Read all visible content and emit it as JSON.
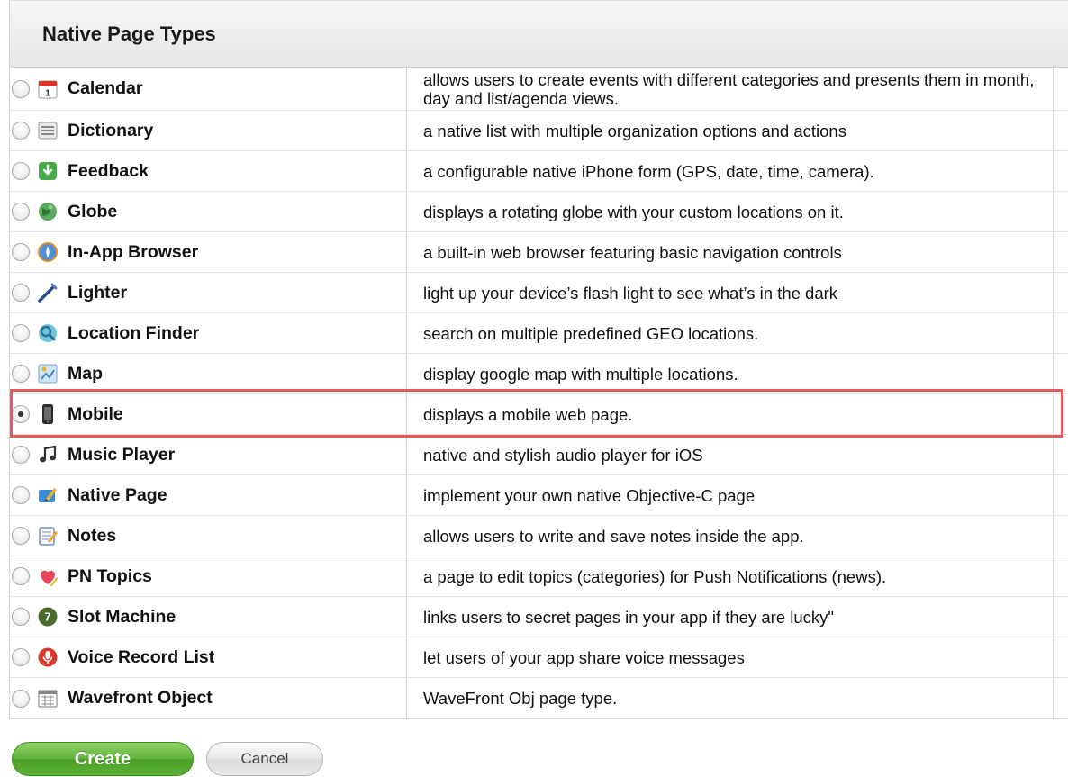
{
  "header": {
    "title": "Native Page Types"
  },
  "rows": [
    {
      "name": "Calendar",
      "icon": "calendar-icon",
      "description": "allows users to create events with different categories and presents them in month, day and list/agenda views.",
      "selected": false
    },
    {
      "name": "Dictionary",
      "icon": "list-icon",
      "description": "a native list with multiple organization options and actions",
      "selected": false
    },
    {
      "name": "Feedback",
      "icon": "feedback-icon",
      "description": "a configurable native iPhone form (GPS, date, time, camera).",
      "selected": false
    },
    {
      "name": "Globe",
      "icon": "globe-icon",
      "description": "displays a rotating globe with your custom locations on it.",
      "selected": false
    },
    {
      "name": "In-App Browser",
      "icon": "browser-icon",
      "description": "a built-in web browser featuring basic navigation controls",
      "selected": false
    },
    {
      "name": "Lighter",
      "icon": "lighter-icon",
      "description": "light up your device’s flash light to see what’s in the dark",
      "selected": false
    },
    {
      "name": "Location Finder",
      "icon": "location-icon",
      "description": "search on multiple predefined GEO locations.",
      "selected": false
    },
    {
      "name": "Map",
      "icon": "map-icon",
      "description": "display google map with multiple locations.",
      "selected": false
    },
    {
      "name": "Mobile",
      "icon": "mobile-icon",
      "description": "displays a mobile web page.",
      "selected": true
    },
    {
      "name": "Music Player",
      "icon": "music-icon",
      "description": "native and stylish audio player for iOS",
      "selected": false
    },
    {
      "name": "Native Page",
      "icon": "native-page-icon",
      "description": "implement your own native Objective-C page",
      "selected": false
    },
    {
      "name": "Notes",
      "icon": "notes-icon",
      "description": "allows users to write and save notes inside the app.",
      "selected": false
    },
    {
      "name": "PN Topics",
      "icon": "pn-topics-icon",
      "description": "a page to edit topics (categories) for Push Notifications (news).",
      "selected": false
    },
    {
      "name": "Slot Machine",
      "icon": "slot-machine-icon",
      "description": "links users to secret pages in your app if they are lucky\"",
      "selected": false
    },
    {
      "name": "Voice Record List",
      "icon": "microphone-icon",
      "description": "let users of your app share voice messages",
      "selected": false
    },
    {
      "name": "Wavefront Object",
      "icon": "wavefront-icon",
      "description": "WaveFront Obj page type.",
      "selected": false
    }
  ],
  "buttons": {
    "create": "Create",
    "cancel": "Cancel"
  },
  "colors": {
    "highlight": "#e25a5a",
    "create_button": "#5fb33a"
  }
}
